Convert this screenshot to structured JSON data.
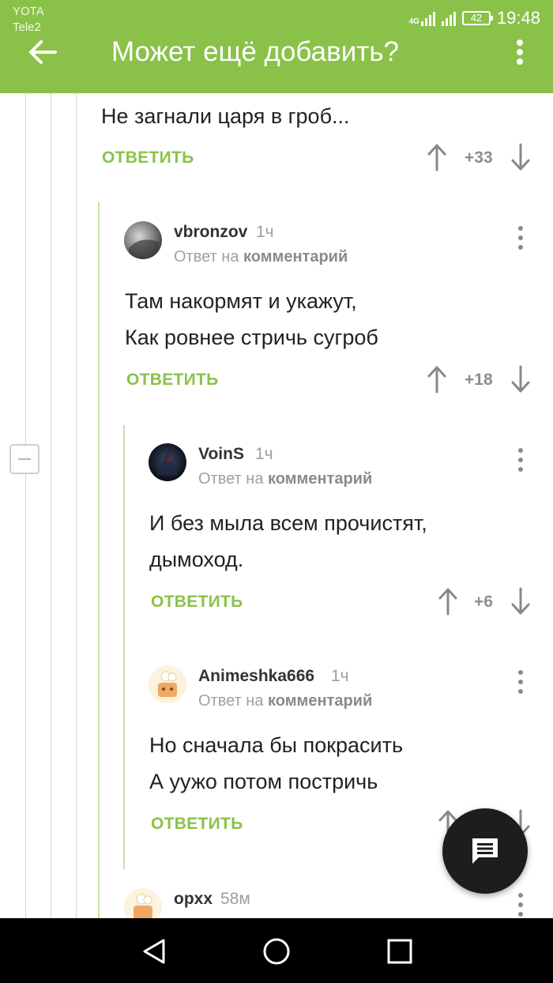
{
  "status_bar": {
    "carrier1": "YOTA",
    "carrier2": "Tele2",
    "network": "4G",
    "battery": "42",
    "time": "19:48"
  },
  "header": {
    "title": "Может ещё добавить?",
    "background": "#8ac249"
  },
  "top_comment": {
    "text": "Не загнали царя в гроб...",
    "reply_label": "ОТВЕТИТЬ",
    "score": "+33"
  },
  "comments": [
    {
      "username": "vbronzov",
      "time": "1ч",
      "reply_prefix": "Ответ на",
      "reply_target": "комментарий",
      "lines": [
        "Там накормят и укажут,",
        "Как ровнее стричь сугроб"
      ],
      "reply_label": "ОТВЕТИТЬ",
      "score": "+18"
    },
    {
      "username": "VoinS",
      "time": "1ч",
      "reply_prefix": "Ответ на",
      "reply_target": "комментарий",
      "lines": [
        "И без мыла всем прочистят,",
        "дымоход."
      ],
      "reply_label": "ОТВЕТИТЬ",
      "score": "+6"
    },
    {
      "username": "Animeshka666",
      "time": "1ч",
      "reply_prefix": "Ответ на",
      "reply_target": "комментарий",
      "lines": [
        "Но сначала бы покрасить",
        "А ууж​о потом постричь"
      ],
      "reply_label": "ОТВЕТИТЬ"
    },
    {
      "username": "opxx",
      "time": "58м"
    }
  ],
  "icons": {
    "back": "arrow-left-icon",
    "more": "more-vertical-icon",
    "upvote": "arrow-up-icon",
    "downvote": "arrow-down-icon",
    "fab": "comment-icon",
    "nav_back": "triangle-back-icon",
    "nav_home": "circle-home-icon",
    "nav_recent": "square-recent-icon"
  },
  "colors": {
    "accent": "#8ac249",
    "text": "#222222",
    "muted": "#9e9e9e",
    "fab": "#1d1d1d"
  }
}
